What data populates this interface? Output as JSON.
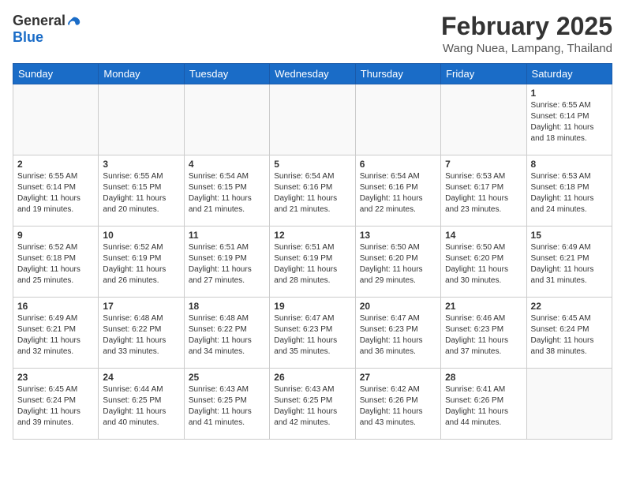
{
  "header": {
    "logo_general": "General",
    "logo_blue": "Blue",
    "month_year": "February 2025",
    "location": "Wang Nuea, Lampang, Thailand"
  },
  "days_of_week": [
    "Sunday",
    "Monday",
    "Tuesday",
    "Wednesday",
    "Thursday",
    "Friday",
    "Saturday"
  ],
  "weeks": [
    [
      {
        "day": "",
        "info": ""
      },
      {
        "day": "",
        "info": ""
      },
      {
        "day": "",
        "info": ""
      },
      {
        "day": "",
        "info": ""
      },
      {
        "day": "",
        "info": ""
      },
      {
        "day": "",
        "info": ""
      },
      {
        "day": "1",
        "info": "Sunrise: 6:55 AM\nSunset: 6:14 PM\nDaylight: 11 hours\nand 18 minutes."
      }
    ],
    [
      {
        "day": "2",
        "info": "Sunrise: 6:55 AM\nSunset: 6:14 PM\nDaylight: 11 hours\nand 19 minutes."
      },
      {
        "day": "3",
        "info": "Sunrise: 6:55 AM\nSunset: 6:15 PM\nDaylight: 11 hours\nand 20 minutes."
      },
      {
        "day": "4",
        "info": "Sunrise: 6:54 AM\nSunset: 6:15 PM\nDaylight: 11 hours\nand 21 minutes."
      },
      {
        "day": "5",
        "info": "Sunrise: 6:54 AM\nSunset: 6:16 PM\nDaylight: 11 hours\nand 21 minutes."
      },
      {
        "day": "6",
        "info": "Sunrise: 6:54 AM\nSunset: 6:16 PM\nDaylight: 11 hours\nand 22 minutes."
      },
      {
        "day": "7",
        "info": "Sunrise: 6:53 AM\nSunset: 6:17 PM\nDaylight: 11 hours\nand 23 minutes."
      },
      {
        "day": "8",
        "info": "Sunrise: 6:53 AM\nSunset: 6:18 PM\nDaylight: 11 hours\nand 24 minutes."
      }
    ],
    [
      {
        "day": "9",
        "info": "Sunrise: 6:52 AM\nSunset: 6:18 PM\nDaylight: 11 hours\nand 25 minutes."
      },
      {
        "day": "10",
        "info": "Sunrise: 6:52 AM\nSunset: 6:19 PM\nDaylight: 11 hours\nand 26 minutes."
      },
      {
        "day": "11",
        "info": "Sunrise: 6:51 AM\nSunset: 6:19 PM\nDaylight: 11 hours\nand 27 minutes."
      },
      {
        "day": "12",
        "info": "Sunrise: 6:51 AM\nSunset: 6:19 PM\nDaylight: 11 hours\nand 28 minutes."
      },
      {
        "day": "13",
        "info": "Sunrise: 6:50 AM\nSunset: 6:20 PM\nDaylight: 11 hours\nand 29 minutes."
      },
      {
        "day": "14",
        "info": "Sunrise: 6:50 AM\nSunset: 6:20 PM\nDaylight: 11 hours\nand 30 minutes."
      },
      {
        "day": "15",
        "info": "Sunrise: 6:49 AM\nSunset: 6:21 PM\nDaylight: 11 hours\nand 31 minutes."
      }
    ],
    [
      {
        "day": "16",
        "info": "Sunrise: 6:49 AM\nSunset: 6:21 PM\nDaylight: 11 hours\nand 32 minutes."
      },
      {
        "day": "17",
        "info": "Sunrise: 6:48 AM\nSunset: 6:22 PM\nDaylight: 11 hours\nand 33 minutes."
      },
      {
        "day": "18",
        "info": "Sunrise: 6:48 AM\nSunset: 6:22 PM\nDaylight: 11 hours\nand 34 minutes."
      },
      {
        "day": "19",
        "info": "Sunrise: 6:47 AM\nSunset: 6:23 PM\nDaylight: 11 hours\nand 35 minutes."
      },
      {
        "day": "20",
        "info": "Sunrise: 6:47 AM\nSunset: 6:23 PM\nDaylight: 11 hours\nand 36 minutes."
      },
      {
        "day": "21",
        "info": "Sunrise: 6:46 AM\nSunset: 6:23 PM\nDaylight: 11 hours\nand 37 minutes."
      },
      {
        "day": "22",
        "info": "Sunrise: 6:45 AM\nSunset: 6:24 PM\nDaylight: 11 hours\nand 38 minutes."
      }
    ],
    [
      {
        "day": "23",
        "info": "Sunrise: 6:45 AM\nSunset: 6:24 PM\nDaylight: 11 hours\nand 39 minutes."
      },
      {
        "day": "24",
        "info": "Sunrise: 6:44 AM\nSunset: 6:25 PM\nDaylight: 11 hours\nand 40 minutes."
      },
      {
        "day": "25",
        "info": "Sunrise: 6:43 AM\nSunset: 6:25 PM\nDaylight: 11 hours\nand 41 minutes."
      },
      {
        "day": "26",
        "info": "Sunrise: 6:43 AM\nSunset: 6:25 PM\nDaylight: 11 hours\nand 42 minutes."
      },
      {
        "day": "27",
        "info": "Sunrise: 6:42 AM\nSunset: 6:26 PM\nDaylight: 11 hours\nand 43 minutes."
      },
      {
        "day": "28",
        "info": "Sunrise: 6:41 AM\nSunset: 6:26 PM\nDaylight: 11 hours\nand 44 minutes."
      },
      {
        "day": "",
        "info": ""
      }
    ]
  ]
}
